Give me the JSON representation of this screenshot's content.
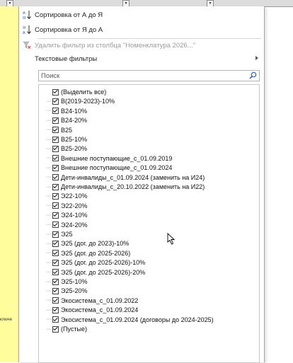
{
  "sheet": {
    "row_label": "ключе",
    "header_letters": "Ке"
  },
  "menu": {
    "sort_asc": "Сортировка от А до Я",
    "sort_desc": "Сортировка от Я до А",
    "clear_filter": "Удалить фильтр из столбца \"Номенклатура 2026...\"",
    "text_filters": "Текстовые фильтры"
  },
  "search": {
    "placeholder": "Поиск"
  },
  "filter_list": {
    "items": [
      {
        "label": "(Выделить все)",
        "checked": true
      },
      {
        "label": "В(2019-2023)-10%",
        "checked": true
      },
      {
        "label": "В24-10%",
        "checked": true
      },
      {
        "label": "В24-20%",
        "checked": true
      },
      {
        "label": "В25",
        "checked": true
      },
      {
        "label": "В25-10%",
        "checked": true
      },
      {
        "label": "В25-20%",
        "checked": true
      },
      {
        "label": "Внешние поступающие_с_01.09.2019",
        "checked": true
      },
      {
        "label": "Внешние поступающие_с_01.09.2024",
        "checked": true
      },
      {
        "label": "Дети-инвалиды_с_01.09.2024 (заменить на И24)",
        "checked": true
      },
      {
        "label": "Дети-инвалиды_с_20.10.2022 (заменить на И22)",
        "checked": true
      },
      {
        "label": "Э22-10%",
        "checked": true
      },
      {
        "label": "Э22-20%",
        "checked": true
      },
      {
        "label": "Э24-10%",
        "checked": true
      },
      {
        "label": "Э24-20%",
        "checked": true
      },
      {
        "label": "Э25",
        "checked": true
      },
      {
        "label": "Э25 (дог. до 2023)-10%",
        "checked": true
      },
      {
        "label": "Э25 (дог. до 2025-2026)",
        "checked": true
      },
      {
        "label": "Э25 (дог. до 2025-2026)-10%",
        "checked": true
      },
      {
        "label": "Э25 (дог. до 2025-2026)-20%",
        "checked": true
      },
      {
        "label": "Э25-10%",
        "checked": true
      },
      {
        "label": "Э25-20%",
        "checked": true
      },
      {
        "label": "Экосистема_с_01.09.2022",
        "checked": true
      },
      {
        "label": "Экосистема_с_01.09.2024",
        "checked": true
      },
      {
        "label": "Экосистема_с_01.09.2024 (договоры до 2024-2025)",
        "checked": true
      },
      {
        "label": "(Пустые)",
        "checked": true
      }
    ]
  },
  "colors": {
    "column_highlight": "#fffd9c",
    "panel_border": "#a7a7a7"
  },
  "icons": {
    "sort_asc": "sort-a-z-icon",
    "sort_desc": "sort-z-a-icon",
    "clear_filter": "funnel-clear-icon",
    "search": "magnifier-icon",
    "submenu": "chevron-right-icon"
  }
}
